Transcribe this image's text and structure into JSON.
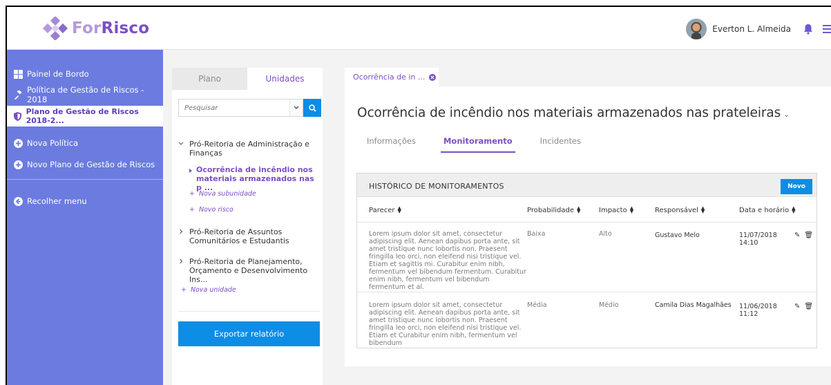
{
  "brand": {
    "part1": "For",
    "part2": "Risco"
  },
  "user": {
    "name": "Everton L. Almeida"
  },
  "sidebar": {
    "items": [
      {
        "label": "Painel de Bordo",
        "icon": "dashboard-icon"
      },
      {
        "label": "Política de Gestão de Riscos - 2018",
        "icon": "gavel-icon"
      },
      {
        "label": "Plano de Gestão de Riscos 2018-2...",
        "icon": "shield-icon",
        "active": true
      },
      {
        "label": "Nova Política",
        "icon": "plus-circle-icon"
      },
      {
        "label": "Novo Plano de Gestão de Riscos",
        "icon": "plus-circle-icon"
      },
      {
        "label": "Recolher menu",
        "icon": "arrow-left-circle-icon"
      }
    ]
  },
  "mid": {
    "tabs": [
      {
        "label": "Plano"
      },
      {
        "label": "Unidades",
        "active": true
      }
    ],
    "search_placeholder": "Pesquisar",
    "tree": [
      {
        "label": "Pró-Reitoria de Administração e Finanças",
        "expanded": true
      },
      {
        "label": "Ocorrência de incêndio nos materiais armazenados nas p ..."
      },
      {
        "label": "Pró-Reitoria de Assuntos Comunitários e Estudantis"
      },
      {
        "label": "Pró-Reitoria de Planejamento, Orçamento e Desenvolvimento Ins..."
      }
    ],
    "add_subunit": "Nova subunidade",
    "add_risk": "Novo risco",
    "add_unit": "Nova unidade",
    "export_label": "Exportar relatório"
  },
  "doc_tab": {
    "label": "Ocorrência de in ..."
  },
  "page": {
    "title": "Ocorrência de incêndio nos materiais armazenados nas prateleiras",
    "tabs": [
      {
        "label": "Informações"
      },
      {
        "label": "Monitoramento",
        "active": true
      },
      {
        "label": "Incidentes"
      }
    ]
  },
  "history": {
    "title": "HISTÓRICO DE MONITORAMENTOS",
    "new_label": "Novo",
    "columns": [
      "Parecer",
      "Probabilidade",
      "Impacto",
      "Responsável",
      "Data e horário"
    ],
    "rows": [
      {
        "parecer": "Lorem ipsum dolor sit amet, consectetur adipiscing elit. Aenean dapibus porta ante, sit amet tristique nunc lobortis non. Praesent fringilla leo orci, non eleifend nisi tristique vel. Etiam et sagittis mi. Curabitur enim nibh, fermentum vel bibendum fermentum. Curabitur enim nibh, fermentum vel bibendum fermentum et al.",
        "probabilidade": "Baixa",
        "impacto": "Alto",
        "responsavel": "Gustavo Melo",
        "data": "11/07/2018",
        "hora": "14:10"
      },
      {
        "parecer": "Lorem ipsum dolor sit amet, consectetur adipiscing elit. Aenean dapibus porta ante, sit amet tristique nunc lobortis non. Praesent fringilla leo orci, non eleifend nisi tristique vel. Etiam et Curabitur enim nibh, fermentum vel bibendum",
        "probabilidade": "Média",
        "impacto": "Médio",
        "responsavel": "Camila Dias Magalhães",
        "data": "11/06/2018",
        "hora": "11:12"
      }
    ]
  },
  "colors": {
    "accent": "#7b4fc4",
    "sidebar": "#6b7bdf",
    "primary_button": "#0d8de6"
  }
}
